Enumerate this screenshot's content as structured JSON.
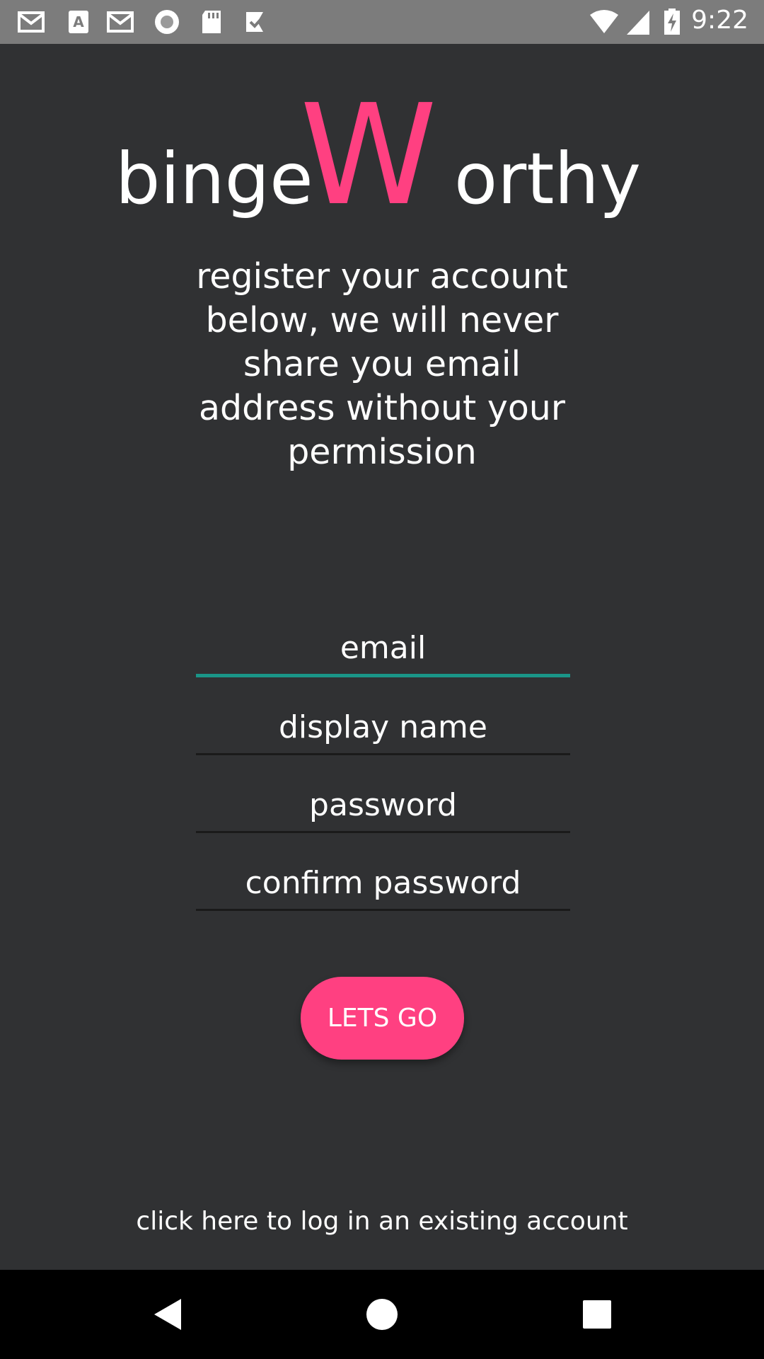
{
  "status_bar": {
    "time": "9:22",
    "icons": [
      "gmail-icon",
      "text-a-icon",
      "gmail-icon",
      "circle-app-icon",
      "sd-card-icon",
      "check-app-icon",
      "wifi-icon",
      "signal-icon",
      "battery-charging-icon"
    ]
  },
  "logo": {
    "part1": "binge",
    "part2": "W",
    "part3": "orthy",
    "accent_color": "#ff4081"
  },
  "tagline": "register your account below, we will never share you email address without your permission",
  "form": {
    "email_placeholder": "email",
    "display_name_placeholder": "display name",
    "password_placeholder": "password",
    "confirm_password_placeholder": "confirm password"
  },
  "button": {
    "label": "LETS GO",
    "color": "#ff4081"
  },
  "login_link": "click here to log in an existing account",
  "nav_bar": {
    "buttons": [
      "back-icon",
      "home-icon",
      "recents-icon"
    ]
  },
  "colors": {
    "background": "#303133",
    "focus_underline": "#1a9588",
    "status_bar": "#7c7c7c"
  }
}
